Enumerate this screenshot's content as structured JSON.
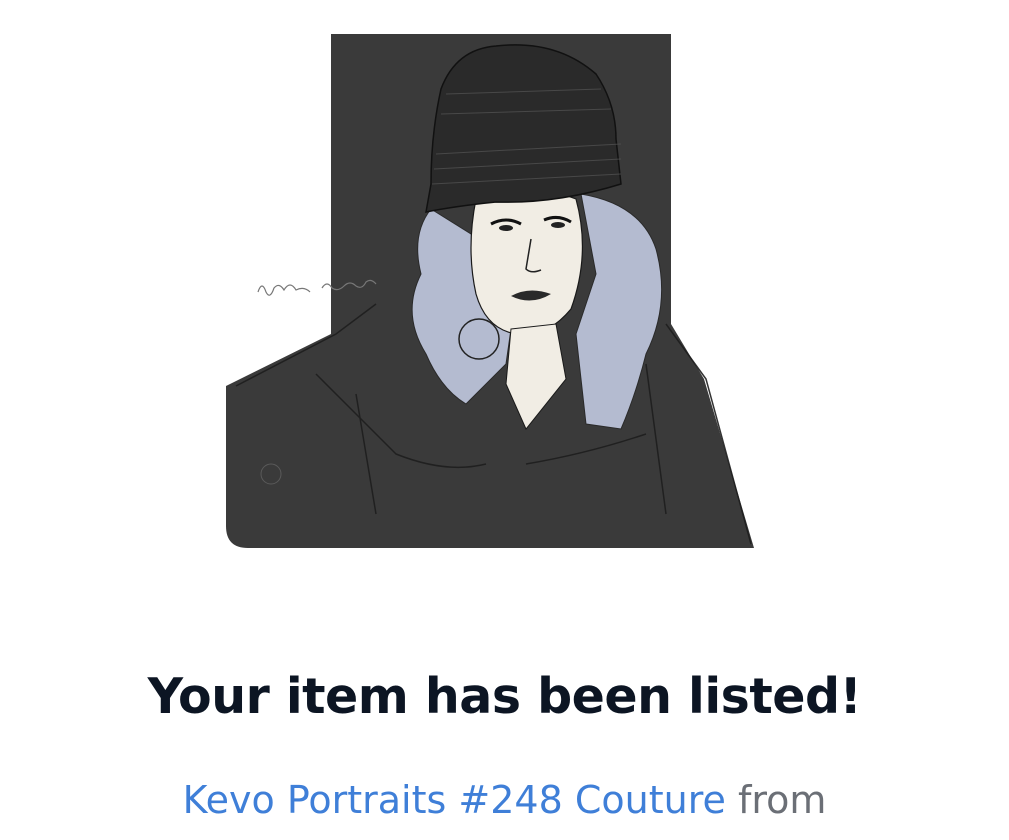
{
  "artwork": {
    "description_icon": "portrait-artwork",
    "signature": "Rikki Kayne 2011",
    "colors": {
      "background": "#3a3a3a",
      "hair": "#b4bbd0",
      "skin": "#f1ede4",
      "line": "#111111"
    }
  },
  "confirmation": {
    "headline": "Your item has been listed!",
    "item_name": "Kevo Portraits #248 Couture",
    "connector": "from"
  },
  "colors": {
    "headline": "#0c1523",
    "link": "#3f7fd8",
    "muted": "#6b6f76"
  }
}
